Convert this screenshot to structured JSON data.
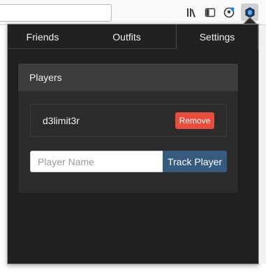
{
  "toolbar": {
    "icons": [
      "library-icon",
      "sidebar-icon",
      "account-icon",
      "extension-icon"
    ]
  },
  "tabs": [
    {
      "label": "Friends"
    },
    {
      "label": "Outfits"
    },
    {
      "label": "Settings"
    }
  ],
  "players_panel": {
    "header": "Players",
    "players": [
      {
        "name": "d3limit3r",
        "remove_label": "Remove"
      }
    ],
    "input_placeholder": "Player Name",
    "track_label": "Track Player"
  },
  "colors": {
    "popup_bg": "#212121",
    "panel_bg": "#2b2b2b",
    "remove": "#e74c3c",
    "primary": "#375a7f"
  }
}
